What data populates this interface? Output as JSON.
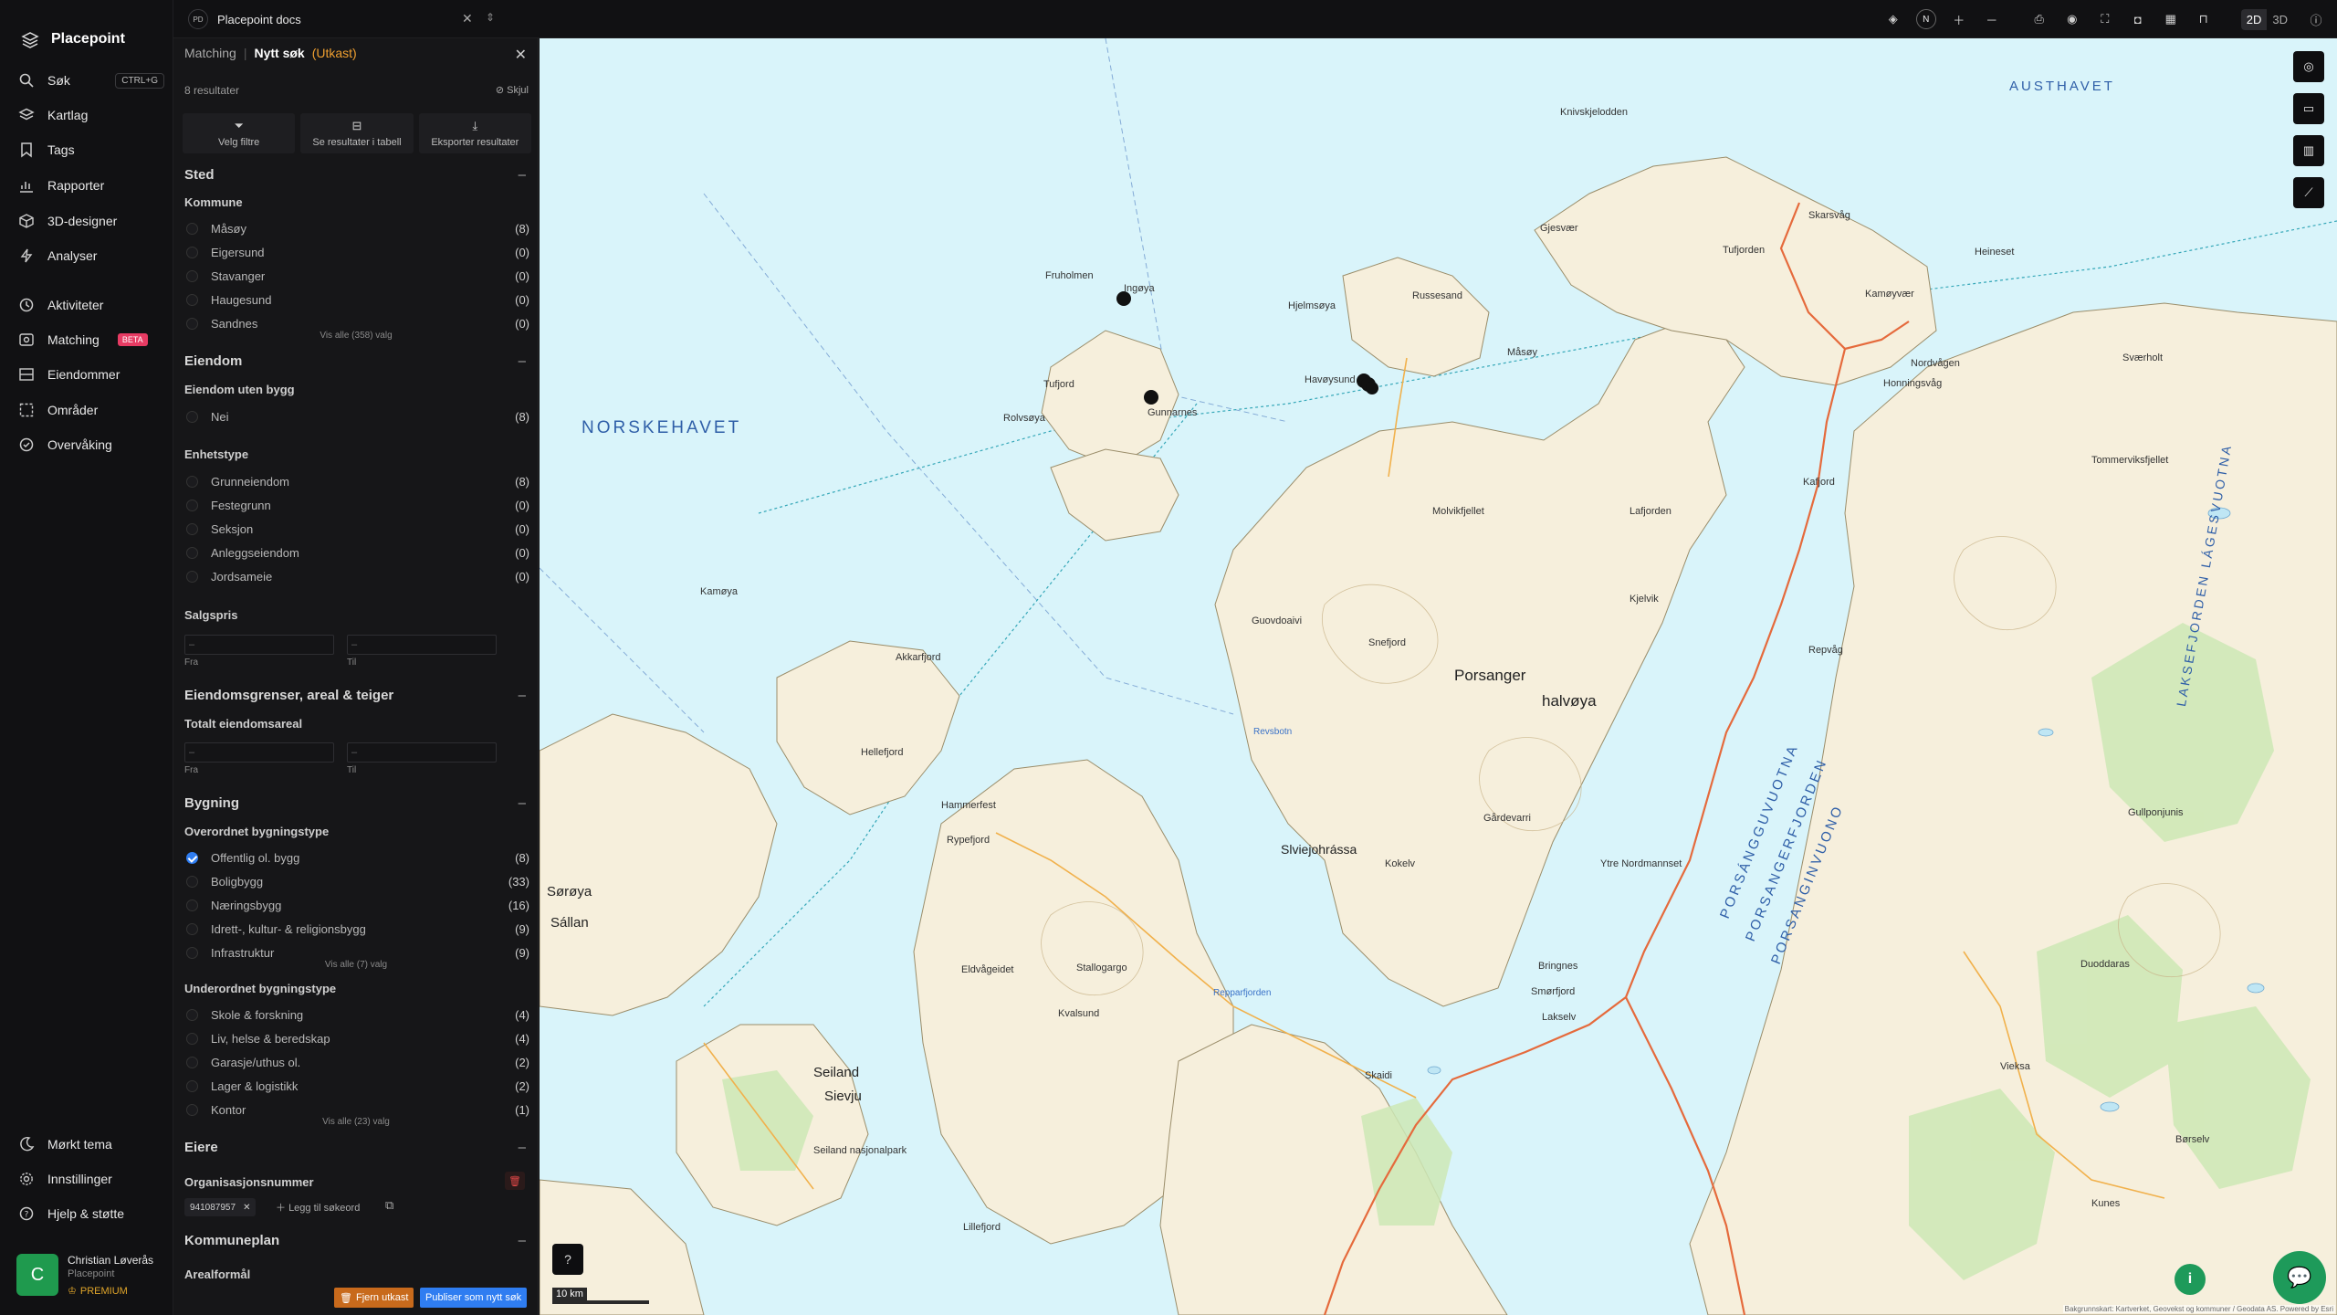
{
  "nav": {
    "brand": "Placepoint",
    "items": [
      {
        "label": "Søk",
        "icon": "search-icon",
        "shortcut": "CTRL+G"
      },
      {
        "label": "Kartlag",
        "icon": "layers-icon"
      },
      {
        "label": "Tags",
        "icon": "bookmark-icon"
      },
      {
        "label": "Rapporter",
        "icon": "chart-icon"
      },
      {
        "label": "3D-designer",
        "icon": "cube-icon"
      },
      {
        "label": "Analyser",
        "icon": "bolt-icon"
      },
      {
        "label": "Aktiviteter",
        "icon": "activity-icon"
      },
      {
        "label": "Matching",
        "icon": "target-icon",
        "badge": "BETA"
      },
      {
        "label": "Eiendommer",
        "icon": "grid-icon"
      },
      {
        "label": "Områder",
        "icon": "area-icon"
      },
      {
        "label": "Overvåking",
        "icon": "radar-icon"
      }
    ],
    "bottom": [
      {
        "label": "Mørkt tema",
        "icon": "moon-icon"
      },
      {
        "label": "Innstillinger",
        "icon": "gear-icon"
      },
      {
        "label": "Hjelp & støtte",
        "icon": "help-icon"
      }
    ],
    "user": {
      "initial": "C",
      "name": "Christian Løverås",
      "org": "Placepoint",
      "plan": "PREMIUM"
    }
  },
  "topbar": {
    "doc_initials": "PD",
    "doc_title": "Placepoint docs",
    "north": "N",
    "mode_2d": "2D",
    "mode_3d": "3D"
  },
  "panel": {
    "crumb_section": "Matching",
    "crumb_title": "Nytt søk",
    "crumb_status": "(Utkast)",
    "result_count": "8 resultater",
    "hide_label": "Skjul",
    "actions": [
      {
        "label": "Velg filtre",
        "icon": "filter-icon"
      },
      {
        "label": "Se resultater i tabell",
        "icon": "table-icon"
      },
      {
        "label": "Eksporter resultater",
        "icon": "download-icon"
      }
    ],
    "sted": {
      "title": "Sted",
      "kommune_label": "Kommune",
      "options": [
        {
          "label": "Måsøy",
          "count": "(8)"
        },
        {
          "label": "Eigersund",
          "count": "(0)"
        },
        {
          "label": "Stavanger",
          "count": "(0)"
        },
        {
          "label": "Haugesund",
          "count": "(0)"
        },
        {
          "label": "Sandnes",
          "count": "(0)"
        }
      ],
      "more": "Vis alle (358) valg"
    },
    "eiendom": {
      "title": "Eiendom",
      "uten_bygg_label": "Eiendom uten bygg",
      "uten_bygg_options": [
        {
          "label": "Nei",
          "count": "(8)"
        }
      ],
      "enhetstype_label": "Enhetstype",
      "enhetstype_options": [
        {
          "label": "Grunneiendom",
          "count": "(8)"
        },
        {
          "label": "Festegrunn",
          "count": "(0)"
        },
        {
          "label": "Seksjon",
          "count": "(0)"
        },
        {
          "label": "Anleggseiendom",
          "count": "(0)"
        },
        {
          "label": "Jordsameie",
          "count": "(0)"
        }
      ],
      "salgspris_label": "Salgspris",
      "from": "Fra",
      "to": "Til",
      "placeholder": "–"
    },
    "grenser": {
      "title": "Eiendomsgrenser, areal & teiger",
      "areal_label": "Totalt eiendomsareal",
      "from": "Fra",
      "to": "Til",
      "placeholder": "–"
    },
    "bygning": {
      "title": "Bygning",
      "over_label": "Overordnet bygningstype",
      "over_options": [
        {
          "label": "Offentlig ol. bygg",
          "count": "(8)",
          "checked": true
        },
        {
          "label": "Boligbygg",
          "count": "(33)"
        },
        {
          "label": "Næringsbygg",
          "count": "(16)"
        },
        {
          "label": "Idrett-, kultur- & religionsbygg",
          "count": "(9)"
        },
        {
          "label": "Infrastruktur",
          "count": "(9)"
        }
      ],
      "over_more": "Vis alle (7) valg",
      "under_label": "Underordnet bygningstype",
      "under_options": [
        {
          "label": "Skole & forskning",
          "count": "(4)"
        },
        {
          "label": "Liv, helse & beredskap",
          "count": "(4)"
        },
        {
          "label": "Garasje/uthus ol.",
          "count": "(2)"
        },
        {
          "label": "Lager & logistikk",
          "count": "(2)"
        },
        {
          "label": "Kontor",
          "count": "(1)"
        }
      ],
      "under_more": "Vis alle (23) valg"
    },
    "eiere": {
      "title": "Eiere",
      "org_label": "Organisasjonsnummer",
      "chip": "941087957",
      "add_keyword": "Legg til søkeord"
    },
    "kommuneplan": {
      "title": "Kommuneplan",
      "arealformal": "Arealformål"
    },
    "remove_draft": "Fjern utkast",
    "publish": "Publiser som nytt søk"
  },
  "map": {
    "scale": "10 km",
    "attribution": "Bakgrunnskart: Kartverket, Geovekst og kommuner / Geodata AS. Powered by Esri",
    "sea_labels": [
      "NORSKEHAVET",
      "AUSTHAVET",
      "LAKSEFJORDEN LÁGESVUOTNA"
    ],
    "fjord_labels": [
      "PORSÁNGGUVUOTNA",
      "PORSANGERFJORDEN",
      "PORSANGINVUONO"
    ],
    "place_labels": [
      "Knivskjelodden",
      "Gjesvær",
      "Skarsvåg",
      "Tufjorden",
      "Kamøyvær",
      "Heineset",
      "Honningsvåg",
      "Nordvågen",
      "Sværholt",
      "Fruholmen",
      "Ingøya",
      "Hjelmsøya",
      "Russesand",
      "Måsøy",
      "Havøysund",
      "Tufjord",
      "Gunnarnes",
      "Rolvsøya",
      "Kafjord",
      "Tommerviksfjellet",
      "Lafjorden",
      "Molvikfjellet",
      "Kjelvik",
      "Repvåg",
      "Kamøya",
      "Akkarfjord",
      "Guovdoaivi",
      "Snefjord",
      "Porsanger",
      "halvøya",
      "Hammerfest",
      "Kvalsund",
      "Revsbotn",
      "Slviejohrássa",
      "Gårdevarri",
      "Ytre Nordmannset",
      "Sørøya",
      "Sállan",
      "Seiland",
      "Sievju",
      "Seiland nasjonalpark",
      "Skaidi",
      "Smørfjord",
      "Lakselv",
      "Vieksa",
      "Duoddaras",
      "Gullponjunis",
      "Børselv",
      "Kunes",
      "Lillefjord",
      "Stallogargo",
      "Eldvågeidet",
      "Kokelv",
      "Repparfjorden",
      "Bringnes",
      "Rypefjord",
      "Hellefjord"
    ]
  }
}
